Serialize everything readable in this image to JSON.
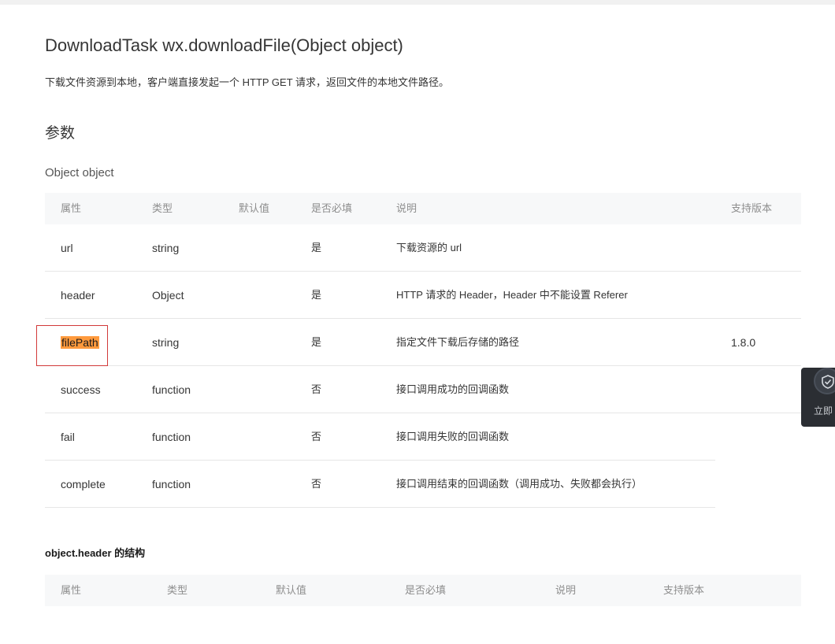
{
  "doc": {
    "title": "DownloadTask wx.downloadFile(Object object)",
    "description": "下载文件资源到本地，客户端直接发起一个 HTTP GET 请求，返回文件的本地文件路径。",
    "params_heading": "参数",
    "object_heading": "Object object"
  },
  "params_table": {
    "headers": [
      "属性",
      "类型",
      "默认值",
      "是否必填",
      "说明",
      "支持版本"
    ],
    "rows": [
      {
        "name": "url",
        "type": "string",
        "default": "",
        "required": "是",
        "desc": "下载资源的 url",
        "version": ""
      },
      {
        "name": "header",
        "type": "Object",
        "default": "",
        "required": "是",
        "desc": "HTTP 请求的 Header，Header 中不能设置 Referer",
        "version": ""
      },
      {
        "name": "filePath",
        "type": "string",
        "default": "",
        "required": "是",
        "desc": "指定文件下载后存储的路径",
        "version": "1.8.0"
      },
      {
        "name": "success",
        "type": "function",
        "default": "",
        "required": "否",
        "desc": "接口调用成功的回调函数",
        "version": ""
      },
      {
        "name": "fail",
        "type": "function",
        "default": "",
        "required": "否",
        "desc": "接口调用失败的回调函数",
        "version": ""
      },
      {
        "name": "complete",
        "type": "function",
        "default": "",
        "required": "否",
        "desc": "接口调用结束的回调函数（调用成功、失败都会执行）",
        "version": ""
      }
    ]
  },
  "struct_section": {
    "heading": "object.header 的结构",
    "headers": [
      "属性",
      "类型",
      "默认值",
      "是否必填",
      "说明",
      "支持版本"
    ]
  },
  "float_widget": {
    "label": "立即",
    "icon": "shield-check-icon"
  },
  "colors": {
    "highlight": "#ff9a3d",
    "annotation_box": "#d23a3a",
    "table_header_bg": "#f7f8f9"
  }
}
